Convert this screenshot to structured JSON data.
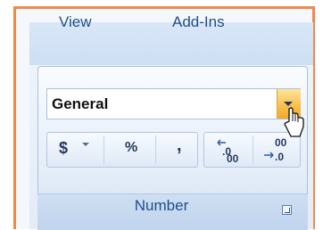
{
  "tabs": {
    "view": "View",
    "addins": "Add-Ins"
  },
  "number_group": {
    "label": "Number",
    "format_value": "General",
    "currency_symbol": "$",
    "percent_symbol": "%",
    "comma_symbol": ","
  },
  "icons": {
    "dialog_launcher": "dialog-launcher-icon",
    "dropdown": "chevron-down-icon",
    "increase_decimal": "increase-decimal-icon",
    "decrease_decimal": "decrease-decimal-icon",
    "cursor": "mouse-pointer-icon"
  },
  "colors": {
    "frame_border": "#ee8a4a",
    "ribbon_text": "#1f4e8a",
    "highlight": "#f7c150"
  }
}
